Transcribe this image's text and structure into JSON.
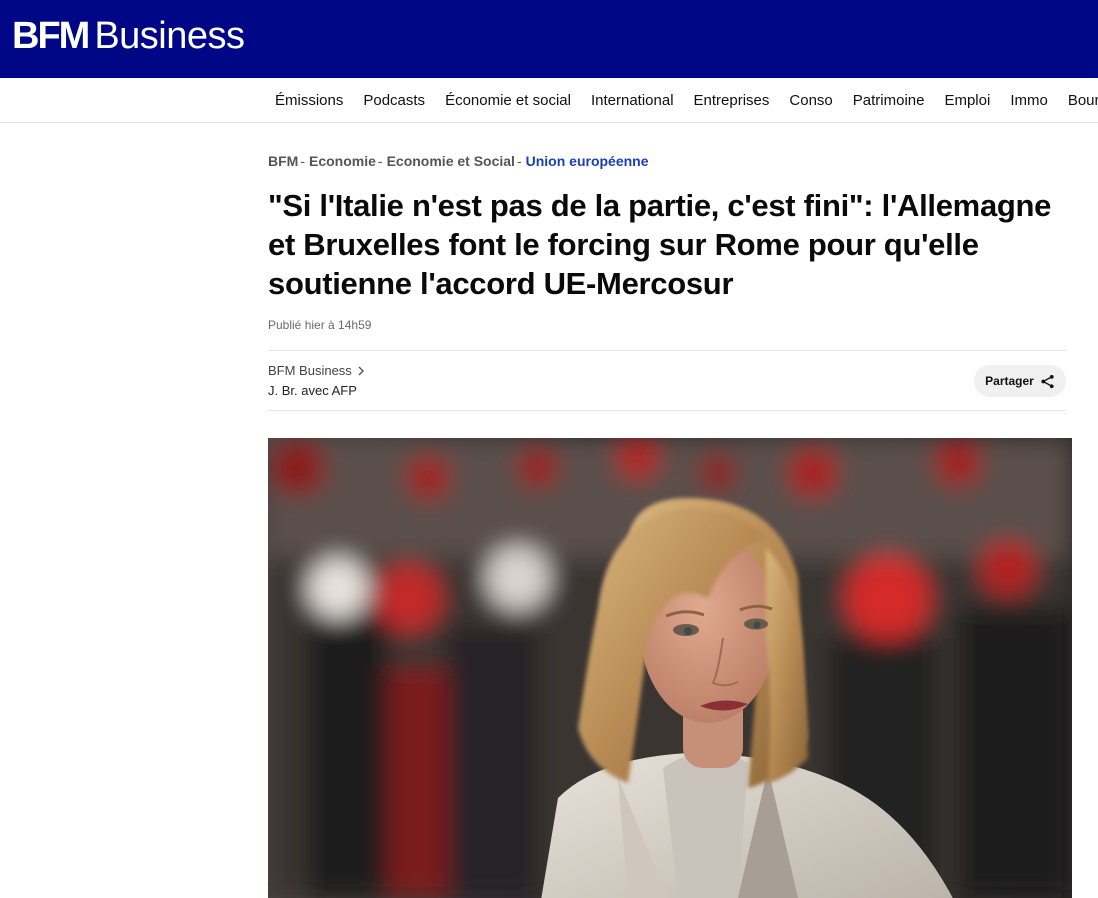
{
  "header": {
    "logo_bold": "BFM",
    "logo_light": "Business"
  },
  "nav": {
    "items": [
      "Émissions",
      "Podcasts",
      "Économie et social",
      "International",
      "Entreprises",
      "Conso",
      "Patrimoine",
      "Emploi",
      "Immo",
      "Bour"
    ]
  },
  "breadcrumb": {
    "items": [
      "BFM",
      "Economie",
      "Economie et Social"
    ],
    "separator": "-",
    "current": "Union européenne"
  },
  "article": {
    "title": "\"Si l'Italie n'est pas de la partie, c'est fini\": l'Allemagne et Bruxelles font le forcing sur Rome pour qu'elle soutienne l'accord UE-Mercosur",
    "published": "Publié hier à 14h59",
    "source": "BFM Business",
    "author": "J. Br. avec AFP",
    "share_label": "Partager"
  },
  "colors": {
    "brand": "#000787",
    "breadcrumb_current": "#1a3eb8"
  }
}
